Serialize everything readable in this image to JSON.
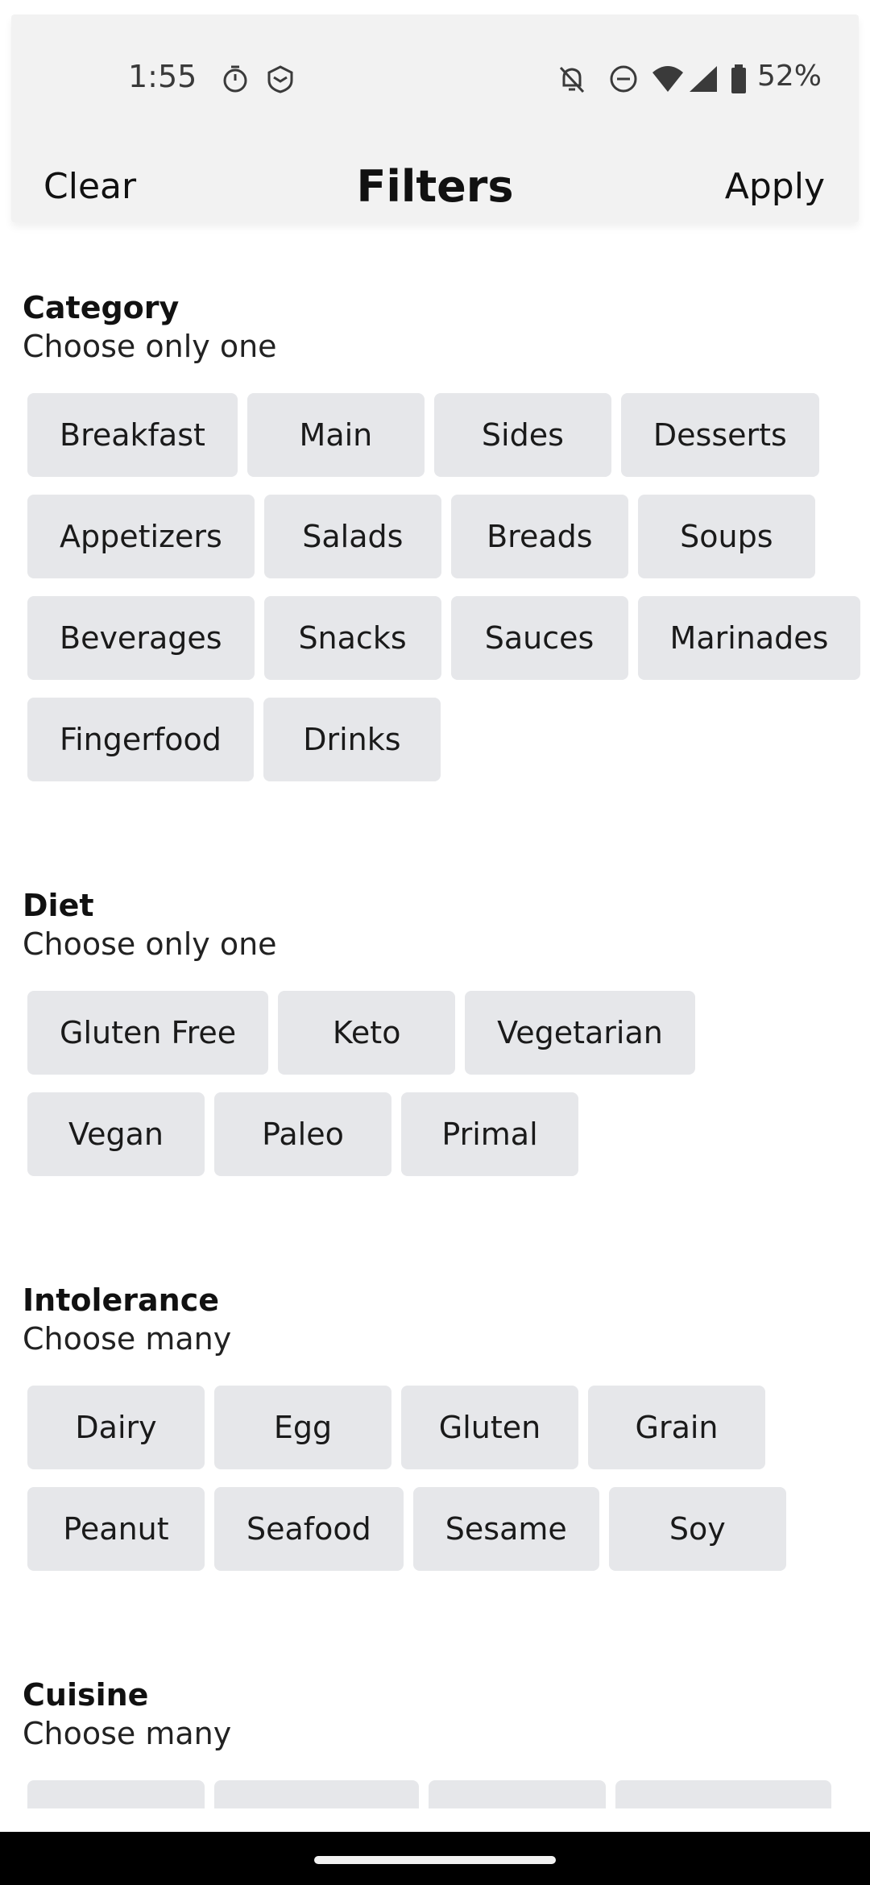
{
  "status_bar": {
    "time": "1:55",
    "battery": "52%",
    "icons": [
      "timer-icon",
      "app-shield-icon",
      "bell-off-icon",
      "do-not-disturb-icon",
      "wifi-icon",
      "cell-signal-icon",
      "battery-icon"
    ]
  },
  "header": {
    "clear_label": "Clear",
    "title": "Filters",
    "apply_label": "Apply"
  },
  "sections": {
    "category": {
      "title": "Category",
      "subtitle": "Choose only one",
      "rows": [
        [
          "Breakfast",
          "Main",
          "Sides",
          "Desserts"
        ],
        [
          "Appetizers",
          "Salads",
          "Breads",
          "Soups"
        ],
        [
          "Beverages",
          "Snacks",
          "Sauces",
          "Marinades"
        ],
        [
          "Fingerfood",
          "Drinks"
        ]
      ]
    },
    "diet": {
      "title": "Diet",
      "subtitle": "Choose only one",
      "rows": [
        [
          "Gluten Free",
          "Keto",
          "Vegetarian"
        ],
        [
          "Vegan",
          "Paleo",
          "Primal"
        ]
      ]
    },
    "intolerance": {
      "title": "Intolerance",
      "subtitle": "Choose many",
      "rows": [
        [
          "Dairy",
          "Egg",
          "Gluten",
          "Grain"
        ],
        [
          "Peanut",
          "Seafood",
          "Sesame",
          "Soy"
        ]
      ]
    },
    "cuisine": {
      "title": "Cuisine",
      "subtitle": "Choose many"
    }
  },
  "colors": {
    "chip_bg": "#e6e7ea",
    "header_bg": "#f2f2f2",
    "nav_bar": "#000000"
  }
}
